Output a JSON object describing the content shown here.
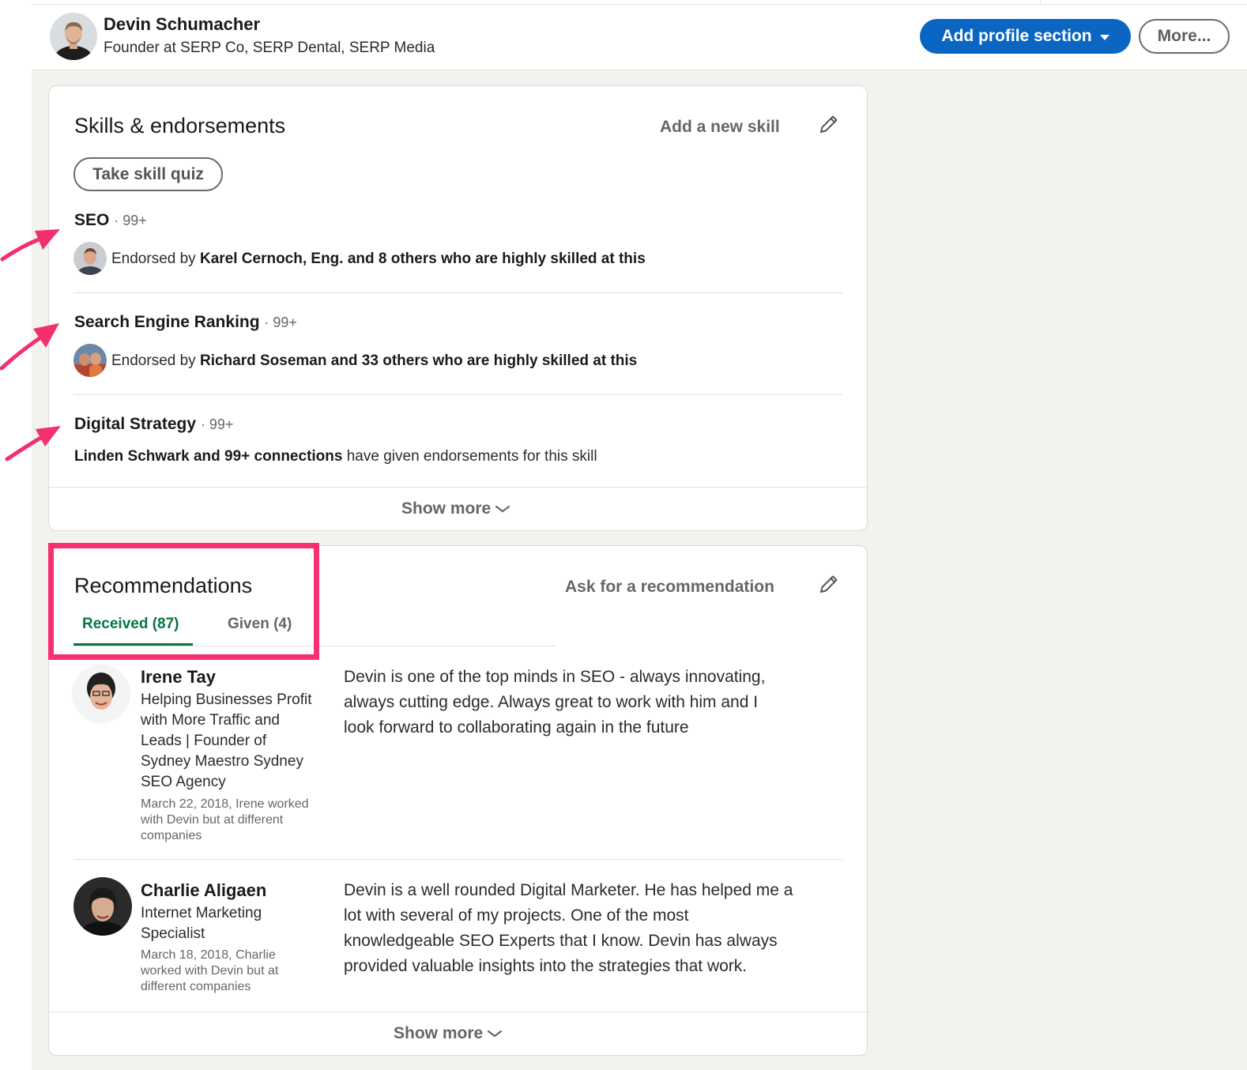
{
  "profile": {
    "name": "Devin Schumacher",
    "headline": "Founder at SERP Co, SERP Dental, SERP Media",
    "add_section_label": "Add profile section",
    "more_label": "More..."
  },
  "skills": {
    "title": "Skills & endorsements",
    "add_skill_label": "Add a new skill",
    "quiz_label": "Take skill quiz",
    "items": [
      {
        "name": "SEO",
        "count": "· 99+",
        "prefix": "Endorsed by ",
        "endorsers": "Karel Cernoch, Eng. and 8 others who are highly skilled at this"
      },
      {
        "name": "Search Engine Ranking",
        "count": "· 99+",
        "prefix": "Endorsed by ",
        "endorsers": "Richard Soseman and 33 others who are highly skilled at this"
      },
      {
        "name": "Digital Strategy",
        "count": "· 99+",
        "connections": "Linden Schwark and 99+ connections",
        "suffix": " have given endorsements for this skill"
      }
    ],
    "show_more_label": "Show more"
  },
  "recommendations": {
    "title": "Recommendations",
    "ask_label": "Ask for a recommendation",
    "tabs": [
      {
        "label": "Received (87)",
        "active": true
      },
      {
        "label": "Given (4)",
        "active": false
      }
    ],
    "items": [
      {
        "name": "Irene Tay",
        "headline_lines": [
          "Helping Businesses Profit",
          "with More Traffic and",
          "Leads | Founder of",
          "Sydney Maestro Sydney",
          "SEO Agency"
        ],
        "date_lines": [
          "March 22, 2018, Irene worked",
          "with Devin but at different",
          "companies"
        ],
        "text_lines": [
          "Devin is one of the top minds in SEO - always innovating,",
          "always cutting edge. Always great to work with him and I",
          "look forward to collaborating again in the future"
        ]
      },
      {
        "name": "Charlie Aligaen",
        "headline_lines": [
          "Internet Marketing",
          "Specialist"
        ],
        "date_lines": [
          "March 18, 2018, Charlie",
          "worked with Devin but at",
          "different companies"
        ],
        "text_lines": [
          "Devin is a well rounded Digital Marketer. He has helped me a",
          "lot with several of my projects. One of the most",
          "knowledgeable SEO Experts that I know. Devin has always",
          "provided valuable insights into the strategies that work."
        ]
      }
    ],
    "show_more_label": "Show more"
  },
  "colors": {
    "accent_blue": "#0a66c2",
    "tab_green": "#057642",
    "annotation_pink": "#f7306f",
    "page_bg": "#f3f2ef"
  },
  "icons": [
    "pencil-icon",
    "chevron-down-icon",
    "caret-down-icon",
    "annotation-arrow"
  ]
}
